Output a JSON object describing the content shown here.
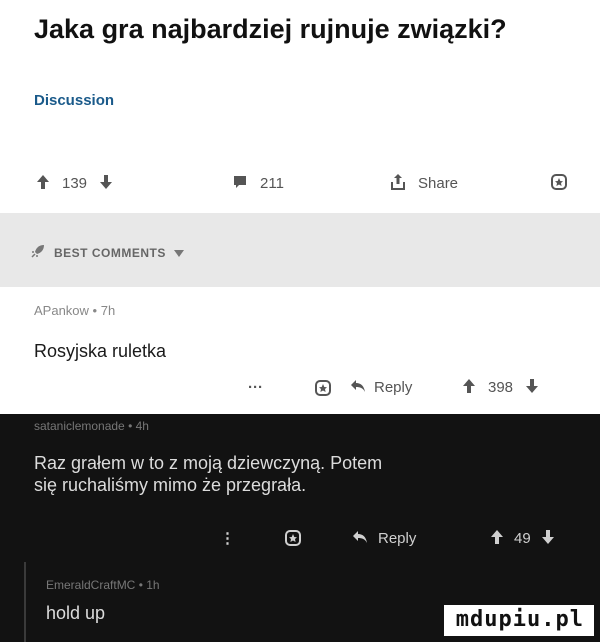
{
  "post": {
    "title": "Jaka gra najbardziej rujnuje związki?",
    "flair": "Discussion",
    "upvote_icon": "arrow-up-icon",
    "score": "139",
    "downvote_icon": "arrow-down-icon",
    "comments_count": "211",
    "share_label": "Share",
    "award_icon": "award-icon"
  },
  "sort": {
    "label": "BEST COMMENTS",
    "rocket_icon": "rocket-icon",
    "chevron_icon": "chevron-down-icon"
  },
  "comments": [
    {
      "author": "APankow",
      "age": "7h",
      "text": "Rosyjska ruletka",
      "more_label": "···",
      "reply_label": "Reply",
      "score": "398"
    },
    {
      "author": "sataniclemonade",
      "age": "4h",
      "text_line1": "Raz grałem w to z moją dziewczyną. Potem",
      "text_line2": "się ruchaliśmy mimo że przegrała.",
      "more_label": "⋮",
      "reply_label": "Reply",
      "score": "49"
    },
    {
      "author": "EmeraldCraftMC",
      "age": "1h",
      "text": "hold up"
    }
  ],
  "watermark": "mdupiu.pl",
  "colors": {
    "flair": "#1a5a8a",
    "sort_bar": "#e8e8e8",
    "dark_bg": "#121212"
  }
}
